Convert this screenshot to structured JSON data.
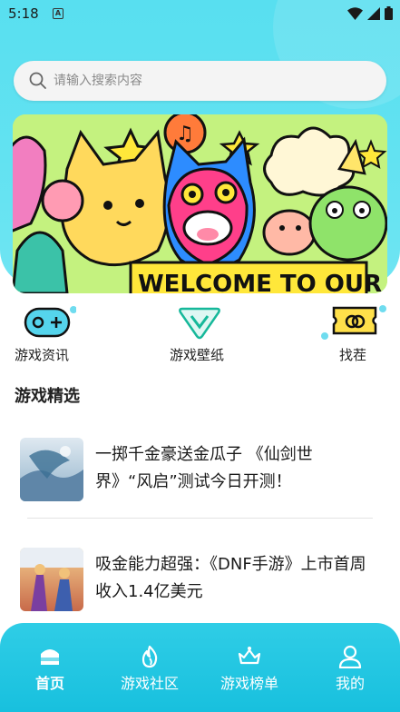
{
  "status_bar": {
    "time": "5:18",
    "notification_icon": "a-icon"
  },
  "search": {
    "placeholder": "请输入搜索内容"
  },
  "banner": {
    "text": "WELCOME TO OUR Y"
  },
  "quick_nav": [
    {
      "label": "游戏资讯",
      "icon": "gamepad-icon"
    },
    {
      "label": "游戏壁纸",
      "icon": "v-badge-icon"
    },
    {
      "label": "找茬",
      "icon": "ticket-icon"
    }
  ],
  "section": {
    "title": "游戏精选"
  },
  "news": [
    {
      "title": "一掷千金豪送金瓜子 《仙剑世界》“风启”测试今日开测！"
    },
    {
      "title": "吸金能力超强：《DNF手游》上市首周收入1.4亿美元"
    }
  ],
  "tabs": [
    {
      "label": "首页",
      "icon": "home-icon",
      "active": true
    },
    {
      "label": "游戏社区",
      "icon": "flame-icon",
      "active": false
    },
    {
      "label": "游戏榜单",
      "icon": "crown-hand-icon",
      "active": false
    },
    {
      "label": "我的",
      "icon": "person-icon",
      "active": false
    }
  ],
  "colors": {
    "accent": "#1fc6e0",
    "text": "#222222",
    "placeholder": "#8a8a8a"
  }
}
